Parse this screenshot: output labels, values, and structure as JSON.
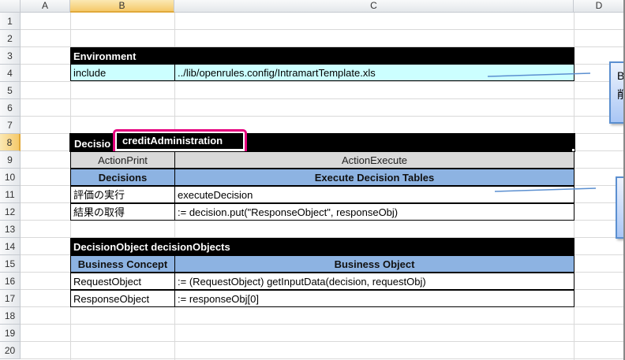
{
  "columns": [
    "A",
    "B",
    "C",
    "D"
  ],
  "selected_column": "B",
  "rows": [
    "1",
    "2",
    "3",
    "4",
    "5",
    "6",
    "7",
    "8",
    "9",
    "10",
    "11",
    "12",
    "13",
    "14",
    "15",
    "16",
    "17",
    "18",
    "19",
    "20"
  ],
  "selected_row": "8",
  "environment": {
    "title": "Environment",
    "key": "include",
    "value": "../lib/openrules.config/IntramartTemplate.xls"
  },
  "decision": {
    "title_prefix": "Decisio",
    "name": "creditAdministration",
    "action_print": "ActionPrint",
    "action_execute": "ActionExecute",
    "col1_header": "Decisions",
    "col2_header": "Execute Decision Tables",
    "rows": [
      {
        "label": "評価の実行",
        "value": "executeDecision"
      },
      {
        "label": "結果の取得",
        "value": ":= decision.put(\"ResponseObject\", responseObj)"
      }
    ]
  },
  "decision_objects": {
    "title": "DecisionObject decisionObjects",
    "col1_header": "Business Concept",
    "col2_header": "Business Object",
    "rows": [
      {
        "label": "RequestObject",
        "value": ":=  (RequestObject) getInputData(decision, requestObj)"
      },
      {
        "label": "ResponseObject",
        "value": ":=  responseObj[0]"
      }
    ]
  },
  "callouts": [
    {
      "line1": "B",
      "line2": "削"
    },
    {
      "line1": "",
      "line2": ""
    }
  ],
  "colors": {
    "highlight": "#e6007e",
    "header_blue": "#8db3e2",
    "cyan": "#ccffff"
  }
}
